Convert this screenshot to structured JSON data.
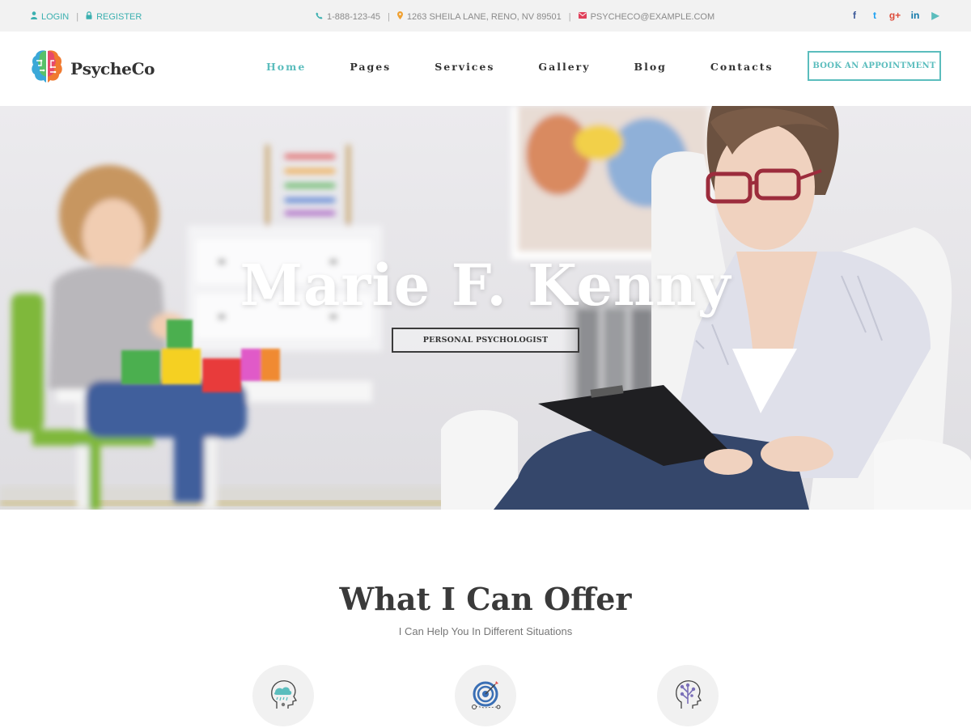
{
  "topbar": {
    "login": "LOGIN",
    "register": "REGISTER",
    "phone": "1-888-123-45",
    "address": "1263 SHEILA LANE, RENO, NV 89501",
    "email": "PSYCHECO@EXAMPLE.COM",
    "social": [
      {
        "name": "facebook-icon",
        "glyph": "f",
        "color": "#3b5998"
      },
      {
        "name": "twitter-icon",
        "glyph": "t",
        "color": "#1da1f2"
      },
      {
        "name": "google-plus-icon",
        "glyph": "g+",
        "color": "#dd4b39"
      },
      {
        "name": "linkedin-icon",
        "glyph": "in",
        "color": "#0e76a8"
      },
      {
        "name": "youtube-play-icon",
        "glyph": "▶",
        "color": "#5bbdbd"
      }
    ]
  },
  "header": {
    "brand": "PsycheCo",
    "nav": [
      "Home",
      "Pages",
      "Services",
      "Gallery",
      "Blog",
      "Contacts"
    ],
    "active_nav": "Home",
    "book_button": "BOOK AN APPOINTMENT"
  },
  "hero": {
    "title": "Marie F. Kenny",
    "tagline": "PERSONAL PSYCHOLOGIST"
  },
  "offer": {
    "title": "What I Can Offer",
    "subtitle": "I Can Help You In Different Situations",
    "icons": [
      "head-cloud-icon",
      "target-icon",
      "head-tree-icon"
    ]
  },
  "colors": {
    "accent": "#5bbdbd",
    "topbar_bg": "#f2f2f2",
    "text_dark": "#333333"
  }
}
